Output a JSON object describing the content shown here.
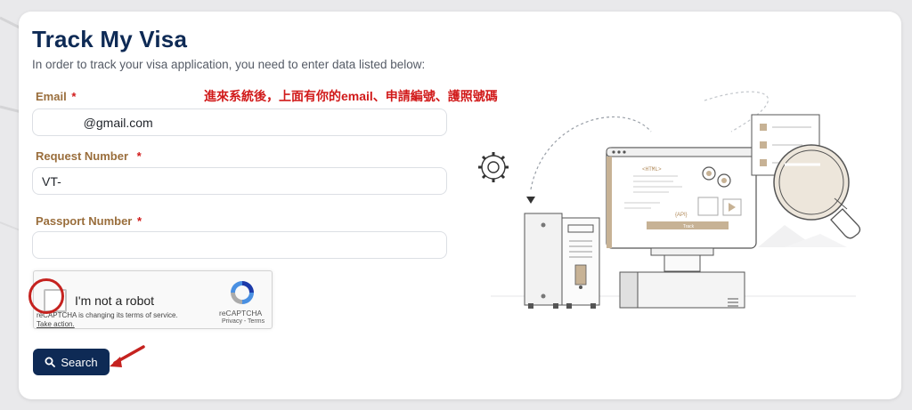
{
  "page": {
    "title": "Track My Visa",
    "subtitle": "In order to track your visa application, you need to enter data listed below:",
    "annotation": "進來系統後，上面有你的email、申請編號、護照號碼"
  },
  "form": {
    "email": {
      "label": "Email",
      "required_mark": "*",
      "value": "            @gmail.com"
    },
    "request_number": {
      "label": "Request Number",
      "required_mark": "*",
      "value": "VT-"
    },
    "passport_number": {
      "label": "Passport Number",
      "required_mark": "*",
      "value": ""
    }
  },
  "recaptcha": {
    "label": "I'm not a robot",
    "notice": "reCAPTCHA is changing its terms of service.",
    "notice_link": "Take action.",
    "brand": "reCAPTCHA",
    "terms": "Privacy - Terms"
  },
  "search_button": {
    "label": "Search",
    "icon": "search-icon"
  },
  "illustration": {
    "html_tag": "<HTML>",
    "api_tag": "{API}",
    "track_label": "Track"
  },
  "colors": {
    "primary_navy": "#0e2a55",
    "label_gold": "#9a6e3c",
    "annotation_red": "#d11a1a"
  }
}
